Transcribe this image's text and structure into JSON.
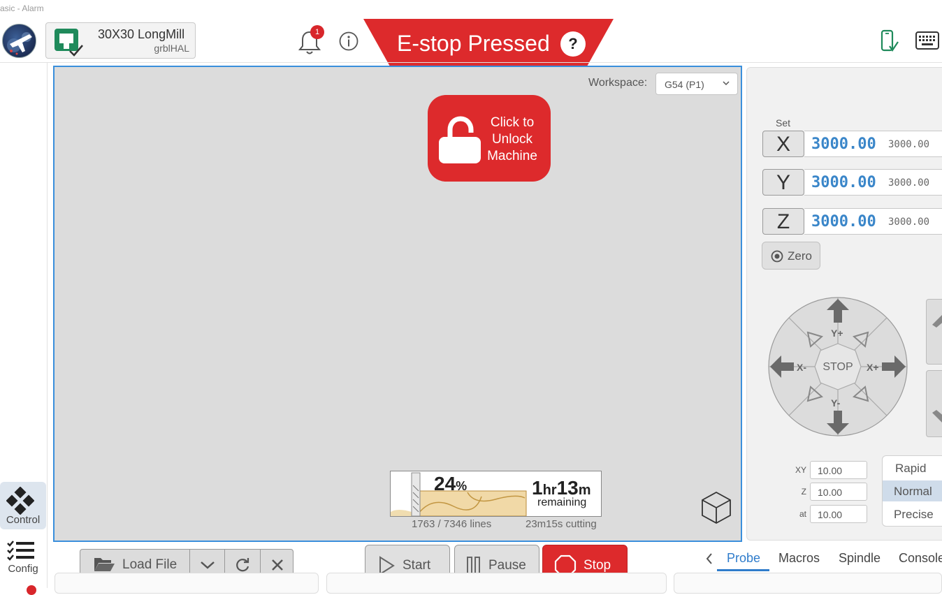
{
  "window": {
    "title": "asic - Alarm"
  },
  "header": {
    "machine_name": "30X30 LongMill",
    "firmware": "grblHAL",
    "notification_count": "1",
    "estop_text": "E-stop Pressed",
    "estop_help": "?"
  },
  "nav": {
    "control_label": "Control",
    "config_label": "Config"
  },
  "visualizer": {
    "workspace_label": "Workspace:",
    "workspace_value": "G54 (P1)",
    "unlock_text": "Click to Unlock Machine",
    "progress_percent": "24",
    "percent_sign": "%",
    "remaining_hours": "1",
    "remaining_hr_unit": "hr",
    "remaining_minutes": "13",
    "remaining_min_unit": "m",
    "remaining_label": "remaining",
    "lines": "1763 / 7346 lines",
    "cutting": "23m15s cutting"
  },
  "dro": {
    "set_label": "Set",
    "axes": [
      {
        "name": "X",
        "work": "3000.00",
        "machine": "3000.00"
      },
      {
        "name": "Y",
        "work": "3000.00",
        "machine": "3000.00"
      },
      {
        "name": "Z",
        "work": "3000.00",
        "machine": "3000.00"
      }
    ],
    "zero_label": "Zero"
  },
  "jog": {
    "stop_label": "STOP",
    "y_plus": "Y+",
    "y_minus": "Y-",
    "x_plus": "X+",
    "x_minus": "X-",
    "steps": [
      {
        "label": "XY",
        "value": "10.00"
      },
      {
        "label": "Z",
        "value": "10.00"
      },
      {
        "label": "at",
        "value": "10.00"
      }
    ],
    "speeds": [
      "Rapid",
      "Normal",
      "Precise"
    ],
    "active_speed": "Normal"
  },
  "toolbar": {
    "load_file": "Load File",
    "start": "Start",
    "pause": "Pause",
    "stop": "Stop"
  },
  "tabs": [
    "Probe",
    "Macros",
    "Spindle",
    "Console"
  ],
  "active_tab": "Probe",
  "colors": {
    "accent": "#3a8fdc",
    "alarm_red": "#dd2a2c",
    "dro_blue": "#3a86c9",
    "machine_icon_green": "#1f8a5b"
  }
}
